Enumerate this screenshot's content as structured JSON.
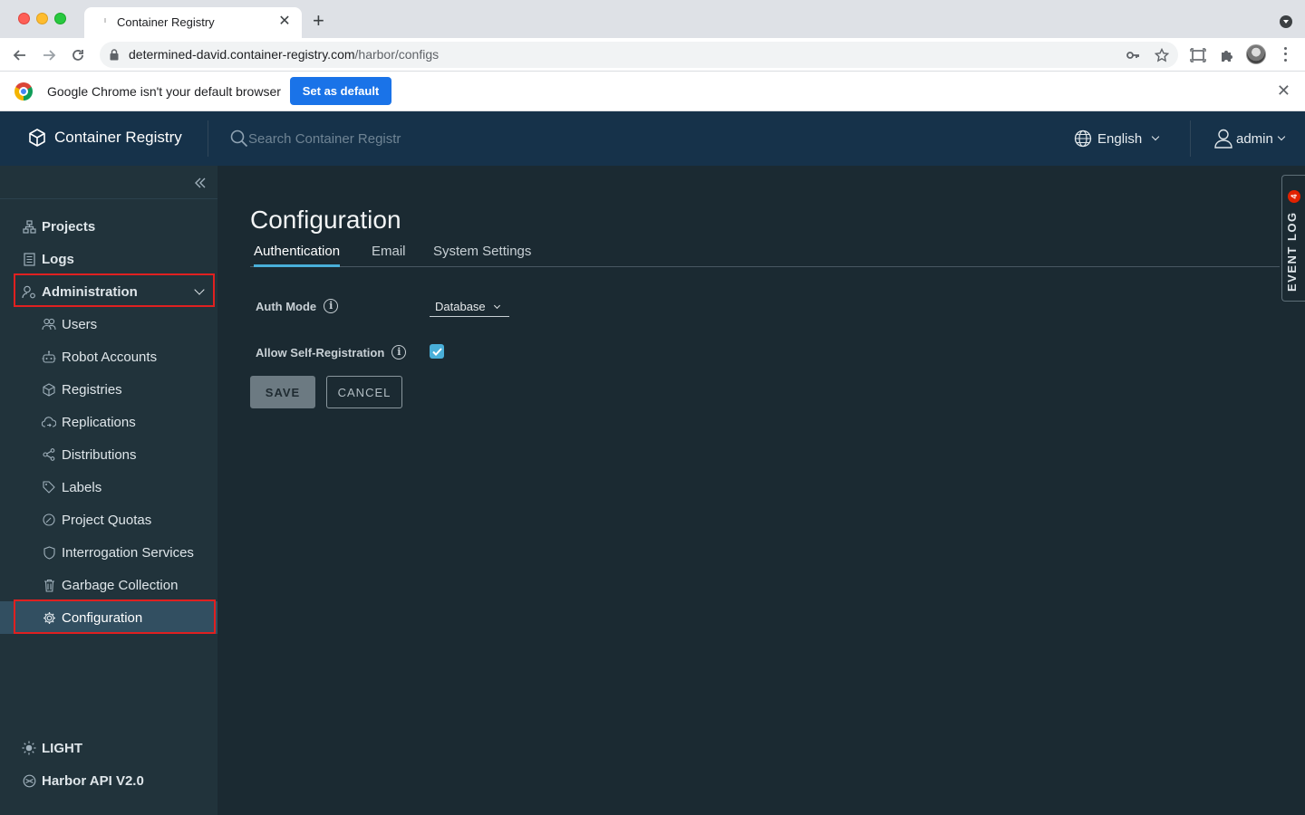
{
  "browser": {
    "tab_title": "Container Registry",
    "new_tab": "+",
    "url_host": "determined-david.container-registry.com",
    "url_path": "/harbor/configs",
    "infobar_text": "Google Chrome isn't your default browser",
    "set_default_label": "Set as default"
  },
  "header": {
    "brand": "Container Registry",
    "search_placeholder": "Search Container Registr",
    "language": "English",
    "user": "admin"
  },
  "sidebar": {
    "items": [
      {
        "label": "Projects",
        "icon": "projects-icon"
      },
      {
        "label": "Logs",
        "icon": "logs-icon"
      },
      {
        "label": "Administration",
        "icon": "administration-icon"
      },
      {
        "label": "Users",
        "icon": "users-icon"
      },
      {
        "label": "Robot Accounts",
        "icon": "robot-icon"
      },
      {
        "label": "Registries",
        "icon": "registries-icon"
      },
      {
        "label": "Replications",
        "icon": "replications-icon"
      },
      {
        "label": "Distributions",
        "icon": "distributions-icon"
      },
      {
        "label": "Labels",
        "icon": "tag-icon"
      },
      {
        "label": "Project Quotas",
        "icon": "quota-icon"
      },
      {
        "label": "Interrogation Services",
        "icon": "shield-icon"
      },
      {
        "label": "Garbage Collection",
        "icon": "trash-icon"
      },
      {
        "label": "Configuration",
        "icon": "gear-icon"
      }
    ],
    "footer": [
      {
        "label": "LIGHT",
        "icon": "sun-icon"
      },
      {
        "label": "Harbor API V2.0",
        "icon": "api-icon"
      }
    ]
  },
  "main": {
    "title": "Configuration",
    "tabs": [
      {
        "label": "Authentication",
        "active": true
      },
      {
        "label": "Email",
        "active": false
      },
      {
        "label": "System Settings",
        "active": false
      }
    ],
    "auth_mode_label": "Auth Mode",
    "auth_mode_value": "Database",
    "self_registration_label": "Allow Self-Registration",
    "self_registration_checked": true,
    "save_label": "SAVE",
    "cancel_label": "CANCEL"
  },
  "event_log": {
    "label": "EVENT LOG",
    "badge": "4"
  },
  "colors": {
    "header_bg": "#16324a",
    "sidebar_bg": "#21333b",
    "content_bg": "#1b2a32",
    "accent": "#49afd9",
    "highlight": "#e02020"
  }
}
